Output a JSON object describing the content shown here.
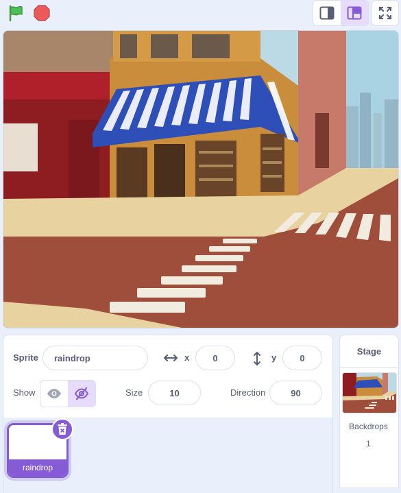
{
  "toolbar": {
    "green_flag_icon": "green-flag-icon",
    "stop_icon": "stop-sign-icon",
    "small_stage_icon": "small-stage-layout-icon",
    "normal_stage_icon": "normal-stage-layout-icon",
    "fullscreen_icon": "fullscreen-icon",
    "active_layout": "normal-stage"
  },
  "colors": {
    "accent": "#855cd6",
    "flag_green": "#45b641",
    "stop_red": "#ec5959",
    "panel_bg": "#e9effb"
  },
  "sprite_info": {
    "sprite_label": "Sprite",
    "sprite_name": "raindrop",
    "x_label": "x",
    "x_value": "0",
    "y_label": "y",
    "y_value": "0",
    "show_label": "Show",
    "show_state": "hidden",
    "size_label": "Size",
    "size_value": "10",
    "direction_label": "Direction",
    "direction_value": "90"
  },
  "sprites": [
    {
      "name": "raindrop",
      "selected": true
    }
  ],
  "stage_panel": {
    "title": "Stage",
    "backdrops_label": "Backdrops",
    "backdrops_count": "1"
  }
}
